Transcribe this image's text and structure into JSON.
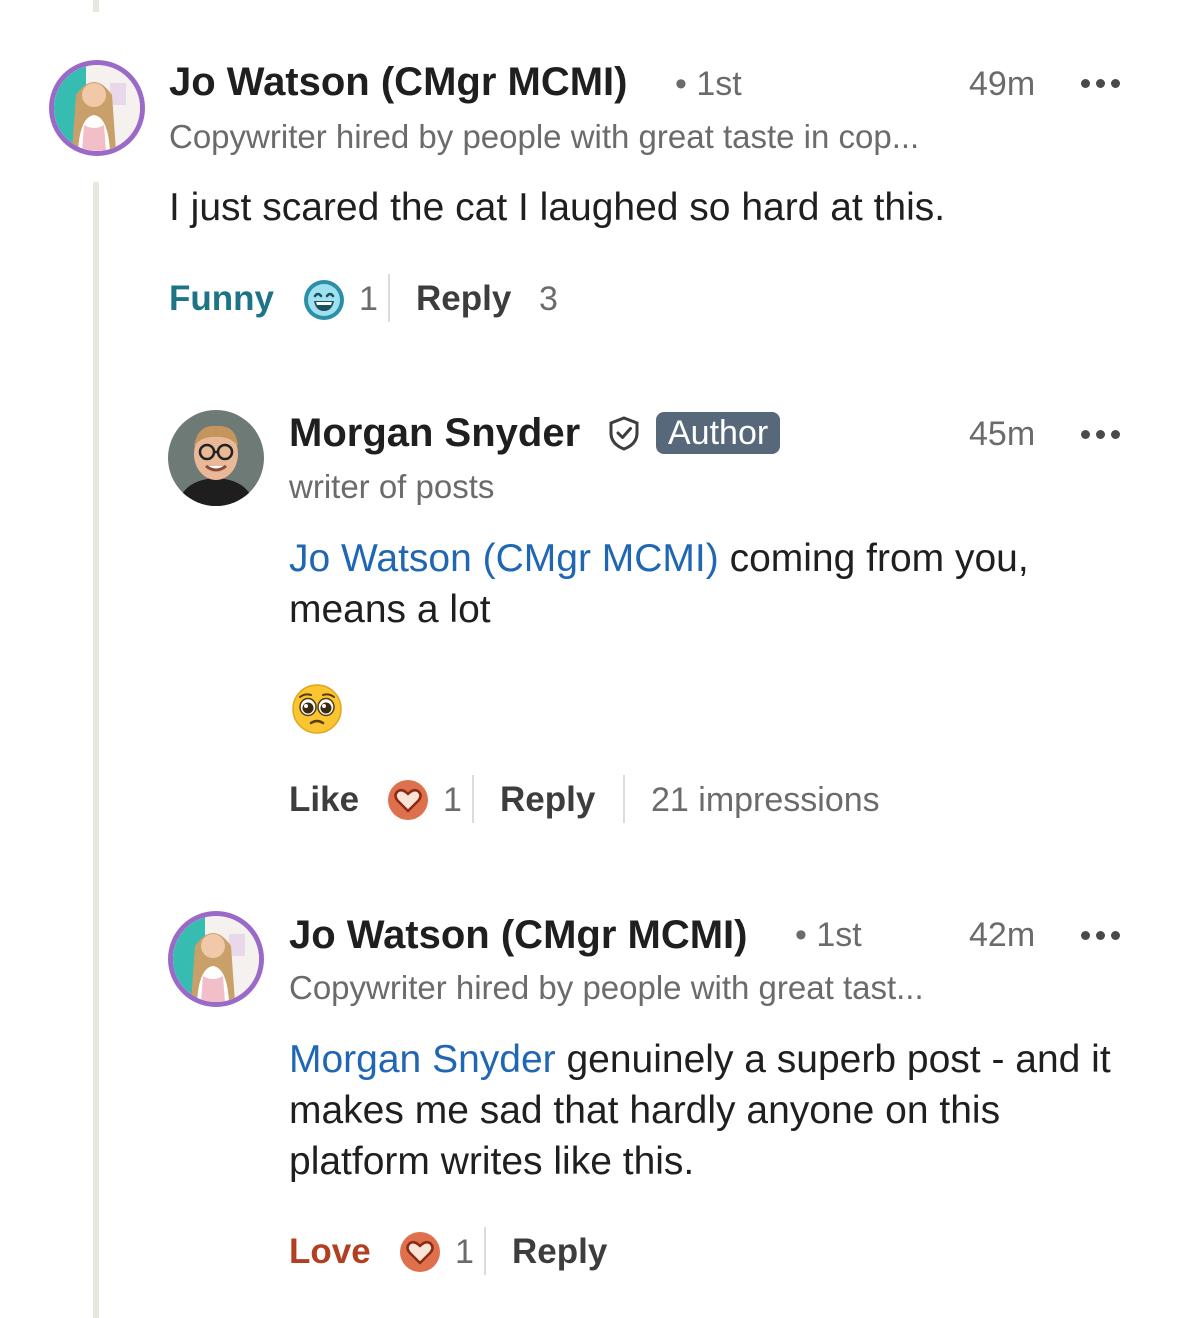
{
  "comments": [
    {
      "author": "Jo Watson (CMgr MCMI)",
      "degree": "• 1st",
      "time": "49m",
      "headline": "Copywriter hired by people with great taste in cop...",
      "text": "I just scared the cat I laughed so hard at this.",
      "reaction_label": "Funny",
      "reaction_count": "1",
      "reply_label": "Reply",
      "reply_count": "3",
      "avatar_icon": "profile-photo-jo"
    },
    {
      "author": "Morgan Snyder",
      "badge": "Author",
      "time": "45m",
      "headline": "writer of posts",
      "mention": "Jo Watson (CMgr MCMI)",
      "text": " coming from you, means a lot",
      "emoji": "pleading-face-emoji",
      "reaction_label": "Like",
      "reaction_count": "1",
      "reply_label": "Reply",
      "impressions": "21 impressions",
      "avatar_icon": "profile-photo-morgan"
    },
    {
      "author": "Jo Watson (CMgr MCMI)",
      "degree": "• 1st",
      "time": "42m",
      "headline": "Copywriter hired by people with great tast...",
      "mention": "Morgan Snyder",
      "text": " genuinely a superb post - and it makes me sad that hardly anyone on this platform writes like this.",
      "reaction_label": "Love",
      "reaction_count": "1",
      "reply_label": "Reply",
      "avatar_icon": "profile-photo-jo"
    }
  ],
  "colors": {
    "funny": "#1d7486",
    "love": "#b24020",
    "mention": "#1f66b3",
    "badge_bg": "#56687a",
    "avatar_ring": "#9b6ac9"
  }
}
